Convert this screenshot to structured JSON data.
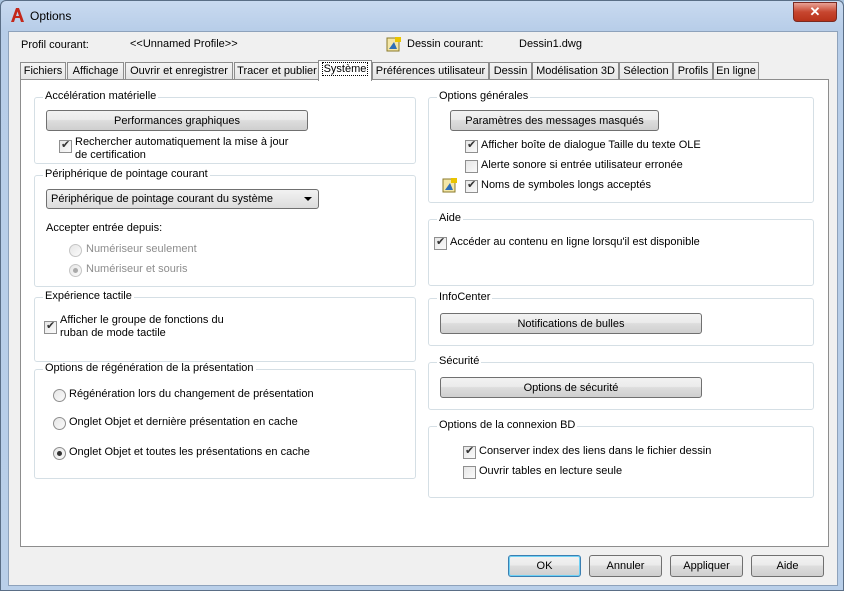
{
  "window": {
    "title": "Options",
    "close_label": "✕"
  },
  "profile": {
    "label": "Profil courant:",
    "value": "<<Unnamed Profile>>"
  },
  "drawing": {
    "label": "Dessin courant:",
    "value": "Dessin1.dwg"
  },
  "tabs": [
    "Fichiers",
    "Affichage",
    "Ouvrir et enregistrer",
    "Tracer et publier",
    "Système",
    "Préférences utilisateur",
    "Dessin",
    "Modélisation 3D",
    "Sélection",
    "Profils",
    "En ligne"
  ],
  "hw": {
    "title": "Accélération matérielle",
    "perf_button": "Performances graphiques",
    "auto_check_line1": "Rechercher automatiquement la mise à jour",
    "auto_check_line2": "de certification"
  },
  "pointing": {
    "title": "Périphérique de pointage courant",
    "selected": "Périphérique de pointage courant du système",
    "accept_label": "Accepter entrée depuis:",
    "radio1": "Numériseur seulement",
    "radio2": "Numériseur et souris"
  },
  "touch": {
    "title": "Expérience tactile",
    "line1": "Afficher le groupe de fonctions du",
    "line2": "ruban de mode tactile"
  },
  "regen": {
    "title": "Options de régénération de la présentation",
    "opt1": "Régénération lors du changement de présentation",
    "opt2": "Onglet Objet et dernière présentation en cache",
    "opt3": "Onglet Objet et toutes les présentations en cache"
  },
  "general": {
    "title": "Options générales",
    "hidden_msgs_button": "Paramètres des messages masqués",
    "ole_dialog": "Afficher boîte de dialogue Taille du texte OLE",
    "beep": "Alerte sonore si entrée utilisateur erronée",
    "long_symbols": "Noms de symboles longs acceptés"
  },
  "help": {
    "title": "Aide",
    "online": "Accéder au contenu en ligne lorsqu'il est disponible"
  },
  "infocenter": {
    "title": "InfoCenter",
    "button": "Notifications de bulles"
  },
  "security": {
    "title": "Sécurité",
    "button": "Options de sécurité"
  },
  "db": {
    "title": "Options de la connexion BD",
    "keep_index": "Conserver index des liens dans le fichier dessin",
    "readonly": "Ouvrir tables en lecture seule"
  },
  "footer": {
    "ok": "OK",
    "cancel": "Annuler",
    "apply": "Appliquer",
    "help": "Aide"
  },
  "colors": {
    "accent_red": "#c4271a",
    "selected_tab_bg": "#ffffff",
    "window_frame": "#b9cfe9"
  }
}
